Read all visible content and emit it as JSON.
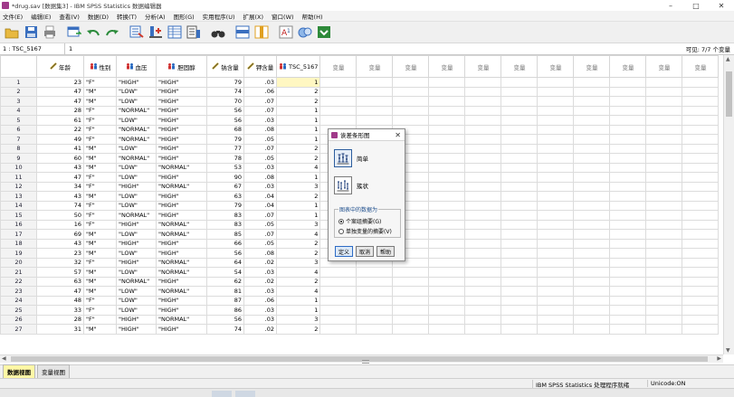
{
  "window": {
    "title": "*drug.sav [数据集3] - IBM SPSS Statistics 数据编辑器"
  },
  "menu": [
    "文件(E)",
    "编辑(E)",
    "查看(V)",
    "数据(D)",
    "转换(T)",
    "分析(A)",
    "图形(G)",
    "实用程序(U)",
    "扩展(X)",
    "窗口(W)",
    "帮助(H)"
  ],
  "cellref": {
    "name": "1 : TSC_5167",
    "value": "1",
    "visible_count": "可见: 7/7 个变量"
  },
  "columns": [
    {
      "label": "年龄",
      "icon": "scale-ruler-icon"
    },
    {
      "label": "性别",
      "icon": "nominal-people-icon"
    },
    {
      "label": "血压",
      "icon": "nominal-people-icon"
    },
    {
      "label": "胆固醇",
      "icon": "nominal-people-icon"
    },
    {
      "label": "钠含量",
      "icon": "scale-ruler-icon"
    },
    {
      "label": "钾含量",
      "icon": "scale-ruler-icon"
    },
    {
      "label": "TSC_5167",
      "icon": "nominal-people-icon"
    }
  ],
  "empty_column_label": "变量",
  "empty_column_count": 11,
  "rows": [
    [
      "23",
      "\"F\"",
      "\"HIGH\"",
      "\"HIGH\"",
      "79",
      ".03",
      "1"
    ],
    [
      "47",
      "\"M\"",
      "\"LOW\"",
      "\"HIGH\"",
      "74",
      ".06",
      "2"
    ],
    [
      "47",
      "\"M\"",
      "\"LOW\"",
      "\"HIGH\"",
      "70",
      ".07",
      "2"
    ],
    [
      "28",
      "\"F\"",
      "\"NORMAL\"",
      "\"HIGH\"",
      "56",
      ".07",
      "1"
    ],
    [
      "61",
      "\"F\"",
      "\"LOW\"",
      "\"HIGH\"",
      "56",
      ".03",
      "1"
    ],
    [
      "22",
      "\"F\"",
      "\"NORMAL\"",
      "\"HIGH\"",
      "68",
      ".08",
      "1"
    ],
    [
      "49",
      "\"F\"",
      "\"NORMAL\"",
      "\"HIGH\"",
      "79",
      ".05",
      "1"
    ],
    [
      "41",
      "\"M\"",
      "\"LOW\"",
      "\"HIGH\"",
      "77",
      ".07",
      "2"
    ],
    [
      "60",
      "\"M\"",
      "\"NORMAL\"",
      "\"HIGH\"",
      "78",
      ".05",
      "2"
    ],
    [
      "43",
      "\"M\"",
      "\"LOW\"",
      "\"NORMAL\"",
      "53",
      ".03",
      "4"
    ],
    [
      "47",
      "\"F\"",
      "\"LOW\"",
      "\"HIGH\"",
      "90",
      ".08",
      "1"
    ],
    [
      "34",
      "\"F\"",
      "\"HIGH\"",
      "\"NORMAL\"",
      "67",
      ".03",
      "3"
    ],
    [
      "43",
      "\"M\"",
      "\"LOW\"",
      "\"HIGH\"",
      "63",
      ".04",
      "2"
    ],
    [
      "74",
      "\"F\"",
      "\"LOW\"",
      "\"HIGH\"",
      "79",
      ".04",
      "1"
    ],
    [
      "50",
      "\"F\"",
      "\"NORMAL\"",
      "\"HIGH\"",
      "83",
      ".07",
      "1"
    ],
    [
      "16",
      "\"F\"",
      "\"HIGH\"",
      "\"NORMAL\"",
      "83",
      ".05",
      "3"
    ],
    [
      "69",
      "\"M\"",
      "\"LOW\"",
      "\"NORMAL\"",
      "85",
      ".07",
      "4"
    ],
    [
      "43",
      "\"M\"",
      "\"HIGH\"",
      "\"HIGH\"",
      "66",
      ".05",
      "2"
    ],
    [
      "23",
      "\"M\"",
      "\"LOW\"",
      "\"HIGH\"",
      "56",
      ".08",
      "2"
    ],
    [
      "32",
      "\"F\"",
      "\"HIGH\"",
      "\"NORMAL\"",
      "64",
      ".02",
      "3"
    ],
    [
      "57",
      "\"M\"",
      "\"LOW\"",
      "\"NORMAL\"",
      "54",
      ".03",
      "4"
    ],
    [
      "63",
      "\"M\"",
      "\"NORMAL\"",
      "\"HIGH\"",
      "62",
      ".02",
      "2"
    ],
    [
      "47",
      "\"M\"",
      "\"LOW\"",
      "\"NORMAL\"",
      "81",
      ".03",
      "4"
    ],
    [
      "48",
      "\"F\"",
      "\"LOW\"",
      "\"HIGH\"",
      "87",
      ".06",
      "1"
    ],
    [
      "33",
      "\"F\"",
      "\"LOW\"",
      "\"HIGH\"",
      "86",
      ".03",
      "1"
    ],
    [
      "28",
      "\"F\"",
      "\"HIGH\"",
      "\"NORMAL\"",
      "56",
      ".03",
      "3"
    ],
    [
      "31",
      "\"M\"",
      "\"HIGH\"",
      "\"HIGH\"",
      "74",
      ".02",
      "2"
    ]
  ],
  "view_tabs": {
    "data": "数据视图",
    "variable": "变量视图"
  },
  "status": {
    "processor": "IBM SPSS Statistics 处理程序就绪",
    "unicode": "Unicode:ON"
  },
  "dialog": {
    "title": "诶差条形图",
    "option_simple": "简单",
    "option_clustered": "簇状",
    "group_label": "图表中的数据为",
    "radio_groups": "个案组摘要(G)",
    "radio_variables": "单独变量的摘要(V)",
    "btn_define": "定义",
    "btn_cancel": "取消",
    "btn_help": "帮助"
  },
  "colors": {
    "selected_cell": "#fff7c2",
    "active_tab": "#fff7a6",
    "accent": "#2d6bc4"
  }
}
